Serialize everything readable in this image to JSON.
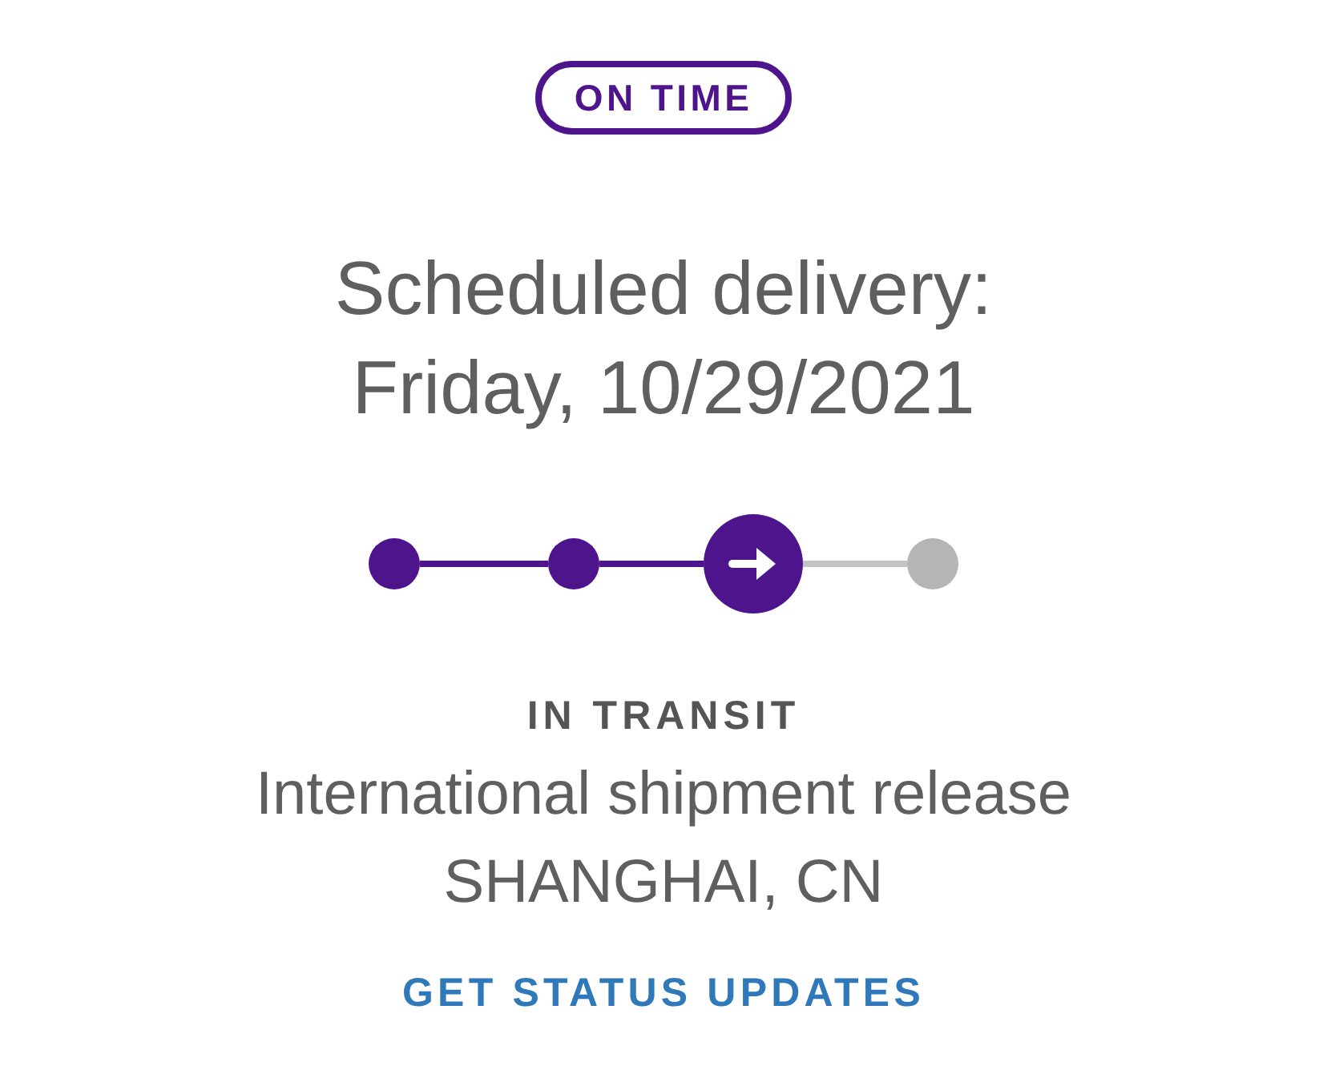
{
  "badge": {
    "label": "ON TIME"
  },
  "delivery": {
    "label": "Scheduled delivery:",
    "date": "Friday, 10/29/2021"
  },
  "progress": {
    "steps": [
      {
        "kind": "done"
      },
      {
        "kind": "done"
      },
      {
        "kind": "current"
      },
      {
        "kind": "pending"
      }
    ]
  },
  "status": {
    "label": "IN TRANSIT",
    "event": "International shipment release",
    "location": "SHANGHAI, CN"
  },
  "link": {
    "label": "GET STATUS UPDATES"
  }
}
